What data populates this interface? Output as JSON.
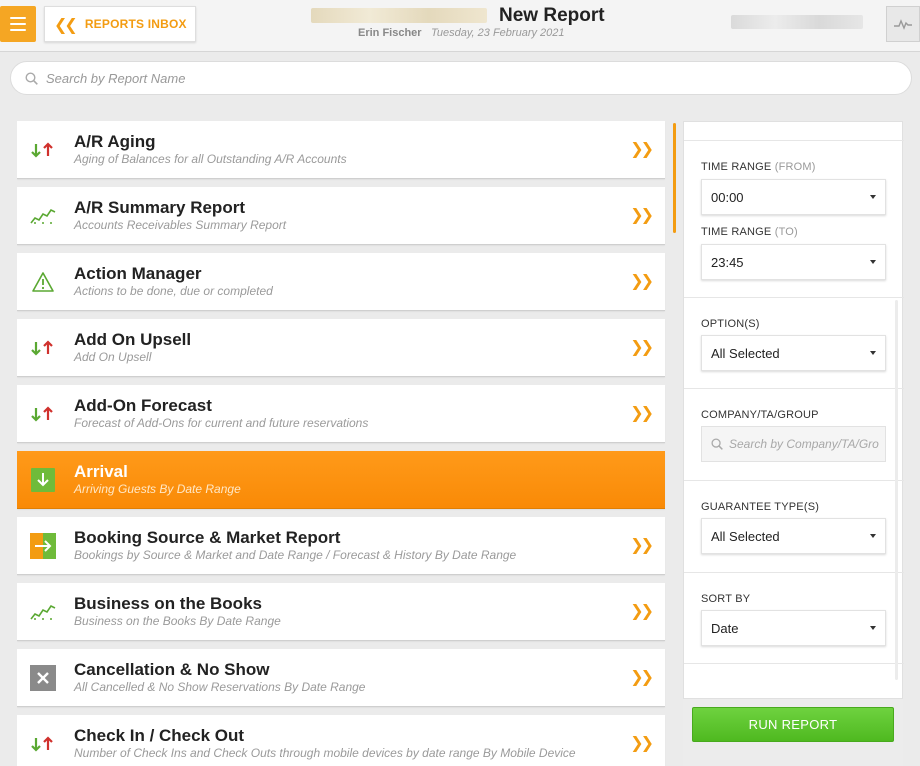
{
  "header": {
    "back_label": "REPORTS INBOX",
    "title": "New Report",
    "user": "Erin Fischer",
    "date": "Tuesday, 23 February 2021"
  },
  "search": {
    "placeholder": "Search by Report Name"
  },
  "reports": [
    {
      "name": "A/R Aging",
      "desc": "Aging of Balances for all Outstanding A/R Accounts",
      "icon": "arrows-up-down-icon"
    },
    {
      "name": "A/R Summary Report",
      "desc": "Accounts Receivables Summary Report",
      "icon": "trend-chart-icon"
    },
    {
      "name": "Action Manager",
      "desc": "Actions to be done, due or completed",
      "icon": "warning-icon"
    },
    {
      "name": "Add On Upsell",
      "desc": "Add On Upsell",
      "icon": "arrows-up-down-icon"
    },
    {
      "name": "Add-On Forecast",
      "desc": "Forecast of Add-Ons for current and future reservations",
      "icon": "arrows-up-down-icon"
    },
    {
      "name": "Arrival",
      "desc": "Arriving Guests By Date Range",
      "icon": "arrival-icon",
      "active": true
    },
    {
      "name": "Booking Source & Market Report",
      "desc": "Bookings by Source & Market and Date Range / Forecast & History By Date Range",
      "icon": "booking-source-icon"
    },
    {
      "name": "Business on the Books",
      "desc": "Business on the Books By Date Range",
      "icon": "trend-chart-icon"
    },
    {
      "name": "Cancellation & No Show",
      "desc": "All Cancelled & No Show Reservations By Date Range",
      "icon": "cancel-x-icon"
    },
    {
      "name": "Check In / Check Out",
      "desc": "Number of Check Ins and Check Outs through mobile devices by date range By Mobile Device",
      "icon": "arrows-up-down-icon"
    }
  ],
  "filters": {
    "time_from_label": "TIME RANGE",
    "time_from_suffix": "(FROM)",
    "time_from_value": "00:00",
    "time_to_label": "TIME RANGE",
    "time_to_suffix": "(TO)",
    "time_to_value": "23:45",
    "options_label": "OPTION(S)",
    "options_value": "All Selected",
    "company_label": "COMPANY/TA/GROUP",
    "company_placeholder": "Search by Company/TA/Group",
    "guarantee_label": "GUARANTEE TYPE(S)",
    "guarantee_value": "All Selected",
    "sort_label": "SORT BY",
    "sort_value": "Date"
  },
  "run_label": "RUN REPORT",
  "colors": {
    "accent": "#f39c12",
    "active": "#fb8c0a",
    "run": "#5cc12c",
    "arrow_down": "#5aa832",
    "arrow_up": "#d0312d"
  }
}
